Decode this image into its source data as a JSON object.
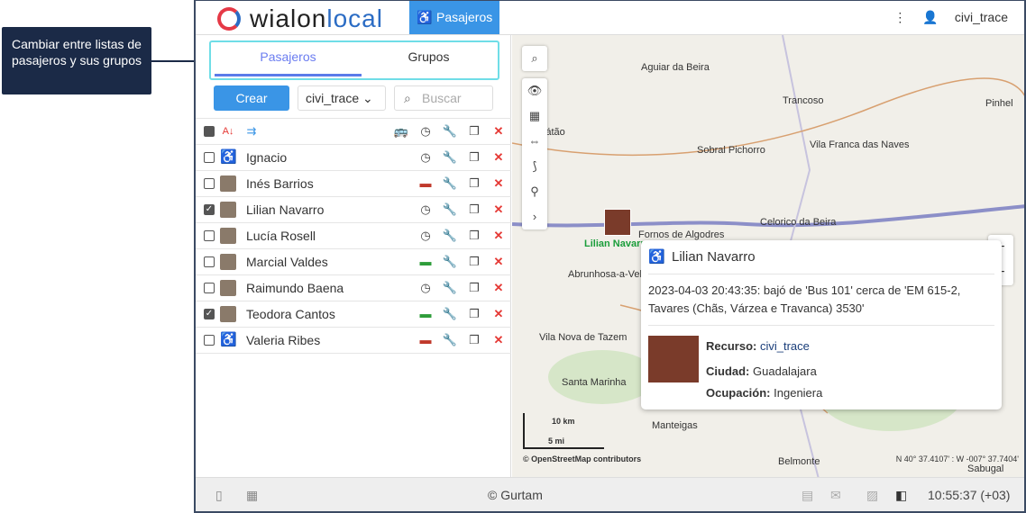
{
  "callout": {
    "text": "Cambiar entre listas de pasajeros y sus grupos"
  },
  "header": {
    "logo_text": "wialon",
    "logo_text2": "local",
    "app_button": "Pasajeros",
    "menu_icon": "⋮",
    "user": "civi_trace"
  },
  "tabs": [
    {
      "label": "Pasajeros",
      "active": true
    },
    {
      "label": "Grupos",
      "active": false
    }
  ],
  "toolbar": {
    "create": "Crear",
    "resource": "civi_trace",
    "search_placeholder": "Buscar"
  },
  "passengers": [
    {
      "name": "Ignacio",
      "checked": false,
      "status": "clock"
    },
    {
      "name": "Inés Barrios",
      "checked": false,
      "status": "bus-red"
    },
    {
      "name": "Lilian Navarro",
      "checked": true,
      "status": "clock"
    },
    {
      "name": "Lucía Rosell",
      "checked": false,
      "status": "clock"
    },
    {
      "name": "Marcial Valdes",
      "checked": false,
      "status": "bus-green"
    },
    {
      "name": "Raimundo Baena",
      "checked": false,
      "status": "clock"
    },
    {
      "name": "Teodora Cantos",
      "checked": true,
      "status": "bus-green"
    },
    {
      "name": "Valeria Ribes",
      "checked": false,
      "status": "bus-red"
    }
  ],
  "map": {
    "labels": [
      "Aguiar da Beira",
      "Trancoso",
      "Pinhel",
      "Sátão",
      "Vila Franca das Naves",
      "Sobral Pichorro",
      "Celorico da Beira",
      "Fornos de Algodres",
      "Abrunhosa-a-Velha",
      "Vila Nova de Tazem",
      "Santa Marinha",
      "Manteigas",
      "Belmonte",
      "Sabugal",
      "Lilian Navarro"
    ],
    "scale_km": "10 km",
    "scale_mi": "5 mi",
    "attribution": "© OpenStreetMap contributors",
    "coords": "N 40° 37.4107' : W -007° 37.7404'"
  },
  "popup": {
    "name": "Lilian Navarro",
    "message": "2023-04-03 20:43:35: bajó de 'Bus 101' cerca de 'EM 615-2, Tavares (Chãs, Várzea e Travanca) 3530'",
    "resource_label": "Recurso:",
    "resource": "civi_trace",
    "city_label": "Ciudad:",
    "city": "Guadalajara",
    "job_label": "Ocupación:",
    "job": "Ingeniera"
  },
  "footer": {
    "copyright": "© Gurtam",
    "time": "10:55:37 (+03)"
  }
}
